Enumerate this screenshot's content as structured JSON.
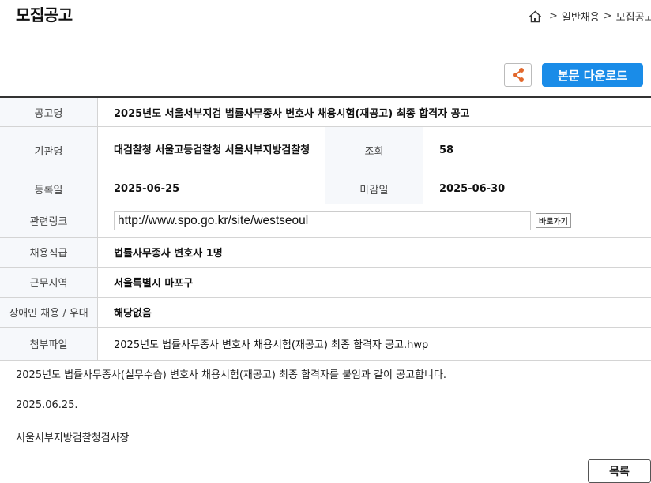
{
  "header": {
    "title": "모집공고",
    "breadcrumb": [
      "일반채용",
      "모집공고"
    ]
  },
  "toolbar": {
    "download_label": "본문 다운로드",
    "share_color": "#e2682c",
    "download_color": "#1a8ce8"
  },
  "info": {
    "notice_name_label": "공고명",
    "notice_name": "2025년도 서울서부지검 법률사무종사 변호사 채용시험(재공고) 최종 합격자 공고",
    "agency_label": "기관명",
    "agency": "대검찰청 서울고등검찰청 서울서부지방검찰청",
    "views_label": "조회",
    "views": "58",
    "reg_date_label": "등록일",
    "reg_date": "2025-06-25",
    "deadline_label": "마감일",
    "deadline": "2025-06-30",
    "link_label": "관련링크",
    "link": "http://www.spo.go.kr/site/westseoul",
    "link_go_label": "바로가기",
    "job_label": "채용직급",
    "job": "법률사무종사 변호사 1명",
    "location_label": "근무지역",
    "location": "서울특별시 마포구",
    "disability_label": "장애인 채용 / 우대",
    "disability": "해당없음",
    "attachment_label": "첨부파일",
    "attachment": "2025년도 법률사무종사 변호사 채용시험(재공고) 최종 합격자 공고.hwp"
  },
  "body": {
    "line1": "2025년도 법률사무종사(실무수습) 변호사 채용시험(재공고) 최종 합격자를 붙임과 같이 공고합니다.",
    "line2": "2025.06.25.",
    "line3": "서울서부지방검찰청검사장"
  },
  "footer": {
    "list_label": "목록"
  }
}
